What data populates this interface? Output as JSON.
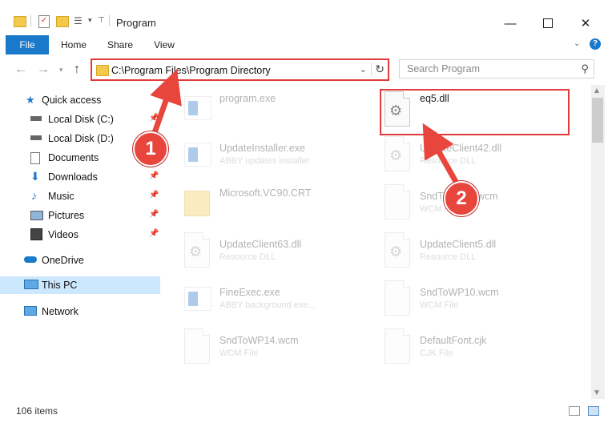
{
  "window": {
    "title": "Program",
    "minimize_icon": "minimize-icon",
    "maximize_icon": "maximize-icon",
    "close_icon": "close-icon"
  },
  "ribbon": {
    "tabs": [
      "File",
      "Home",
      "Share",
      "View"
    ],
    "accent": "#1979ca"
  },
  "address_bar": {
    "path": "C:\\Program Files\\Program Directory",
    "search_placeholder": "Search Program"
  },
  "sidebar": {
    "items": [
      {
        "label": "Quick access",
        "icon": "star-icon"
      },
      {
        "label": "Local Disk (C:)",
        "icon": "drive-icon"
      },
      {
        "label": "Local Disk (D:)",
        "icon": "drive-icon"
      },
      {
        "label": "Documents",
        "icon": "documents-icon"
      },
      {
        "label": "Downloads",
        "icon": "download-icon"
      },
      {
        "label": "Music",
        "icon": "music-icon"
      },
      {
        "label": "Pictures",
        "icon": "pictures-icon"
      },
      {
        "label": "Videos",
        "icon": "videos-icon"
      },
      {
        "label": "OneDrive",
        "icon": "cloud-icon"
      },
      {
        "label": "This PC",
        "icon": "computer-icon"
      },
      {
        "label": "Network",
        "icon": "network-icon"
      }
    ]
  },
  "files": [
    {
      "name": "program.exe",
      "desc": ""
    },
    {
      "name": "eq5.dll",
      "desc": ""
    },
    {
      "name": "UpdateInstaller.exe",
      "desc": "ABBY updates installer"
    },
    {
      "name": "UpdateClient42.dll",
      "desc": "Resource DLL"
    },
    {
      "name": "Microsoft.VC90.CRT",
      "desc": ""
    },
    {
      "name": "SndToWP11.wcm",
      "desc": "WCM File"
    },
    {
      "name": "UpdateClient63.dll",
      "desc": "Resource DLL"
    },
    {
      "name": "UpdateClient5.dll",
      "desc": "Resource DLL"
    },
    {
      "name": "FineExec.exe",
      "desc": "ABBY background exe..."
    },
    {
      "name": "SndToWP10.wcm",
      "desc": "WCM File"
    },
    {
      "name": "SndToWP14.wcm",
      "desc": "WCM File"
    },
    {
      "name": "DefaultFont.cjk",
      "desc": "CJK File"
    }
  ],
  "status": {
    "item_count": "106 items"
  },
  "annotations": {
    "step1": "1",
    "step2": "2",
    "color": "#e03a3a"
  }
}
